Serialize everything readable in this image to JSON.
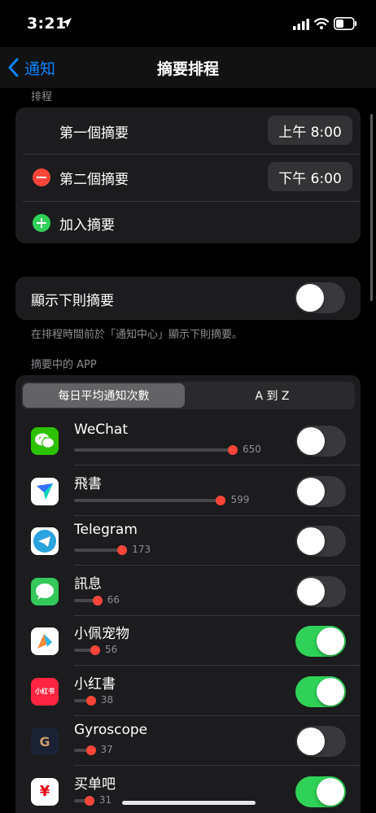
{
  "status": {
    "time": "3:21"
  },
  "nav": {
    "back_label": "通知",
    "title": "摘要排程"
  },
  "schedule": {
    "section_label": "排程",
    "first_label": "第一個摘要",
    "first_time": "上午 8:00",
    "second_label": "第二個摘要",
    "second_time": "下午 6:00",
    "add_label": "加入摘要"
  },
  "next_summary": {
    "label": "顯示下則摘要",
    "enabled": false,
    "footnote": "在排程時間前於「通知中心」顯示下則摘要。"
  },
  "apps_section": {
    "section_label": "摘要中的 APP",
    "sort_options": [
      "每日平均通知次數",
      "A 到 Z"
    ],
    "selected_sort": "每日平均通知次數"
  },
  "apps": [
    {
      "name": "WeChat",
      "count": "650",
      "value": 650,
      "enabled": false,
      "icon": "wechat-icon"
    },
    {
      "name": "飛書",
      "count": "599",
      "value": 599,
      "enabled": false,
      "icon": "feishu-icon"
    },
    {
      "name": "Telegram",
      "count": "173",
      "value": 173,
      "enabled": false,
      "icon": "telegram-icon"
    },
    {
      "name": "訊息",
      "count": "66",
      "value": 66,
      "enabled": false,
      "icon": "messages-icon"
    },
    {
      "name": "小佩宠物",
      "count": "56",
      "value": 56,
      "enabled": true,
      "icon": "petkit-icon"
    },
    {
      "name": "小红書",
      "count": "38",
      "value": 38,
      "enabled": true,
      "icon": "xiaohongshu-icon"
    },
    {
      "name": "Gyroscope",
      "count": "37",
      "value": 37,
      "enabled": false,
      "icon": "gyroscope-icon"
    },
    {
      "name": "买单吧",
      "count": "31",
      "value": 31,
      "enabled": true,
      "icon": "maidanba-icon"
    }
  ],
  "icon_text": {
    "xiaohongshu": "小红书",
    "gyroscope": "G",
    "maidanba": "¥"
  },
  "colors": {
    "accent": "#0a84ff",
    "toggle_on": "#30d158",
    "destructive": "#ff453a",
    "card": "#1c1c1e"
  }
}
